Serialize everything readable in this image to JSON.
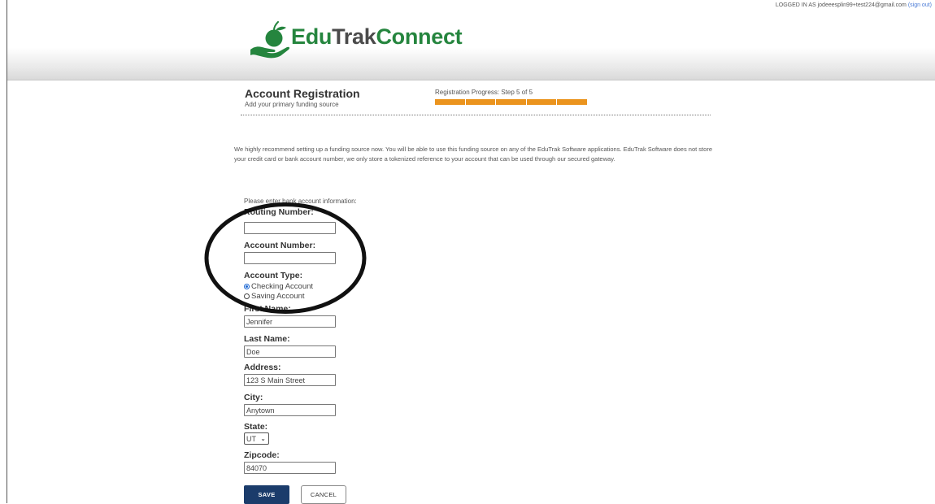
{
  "header": {
    "login_prefix": "LOGGED IN AS jodeeesplin99+test224@gmail.com",
    "sign_out": "(sign out)",
    "logo": {
      "edu": "Edu",
      "trak": "Trak",
      "connect": "Connect"
    },
    "colors": {
      "brand_green": "#25853e",
      "brand_gray": "#4b4b4b"
    }
  },
  "registration": {
    "title": "Account Registration",
    "subtitle": "Add your primary funding source",
    "progress_label": "Registration Progress: Step 5 of 5",
    "progress": {
      "current_step": 5,
      "total_steps": 5,
      "color": "#eb941e"
    }
  },
  "intro_text": "We highly recommend setting up a funding source now. You will be able to use this funding source on any of the EduTrak Software applications. EduTrak Software does not store your credit card or bank account number, we only store a tokenized reference to your account that can be used through our secured gateway.",
  "form": {
    "hint": "Please enter bank account information:",
    "routing": {
      "label": "Routing Number:",
      "value": ""
    },
    "account": {
      "label": "Account Number:",
      "value": ""
    },
    "account_type": {
      "label": "Account Type:",
      "options": [
        "Checking Account",
        "Saving Account"
      ],
      "selected": "Checking Account"
    },
    "first_name": {
      "label": "First Name:",
      "value": "Jennifer"
    },
    "last_name": {
      "label": "Last Name:",
      "value": "Doe"
    },
    "address": {
      "label": "Address:",
      "value": "123 S Main Street"
    },
    "city": {
      "label": "City:",
      "value": "Anytown"
    },
    "state": {
      "label": "State:",
      "value": "UT"
    },
    "zipcode": {
      "label": "Zipcode:",
      "value": "84070"
    }
  },
  "buttons": {
    "save": "SAVE",
    "cancel": "CANCEL",
    "save_color": "#1b3c6b"
  }
}
